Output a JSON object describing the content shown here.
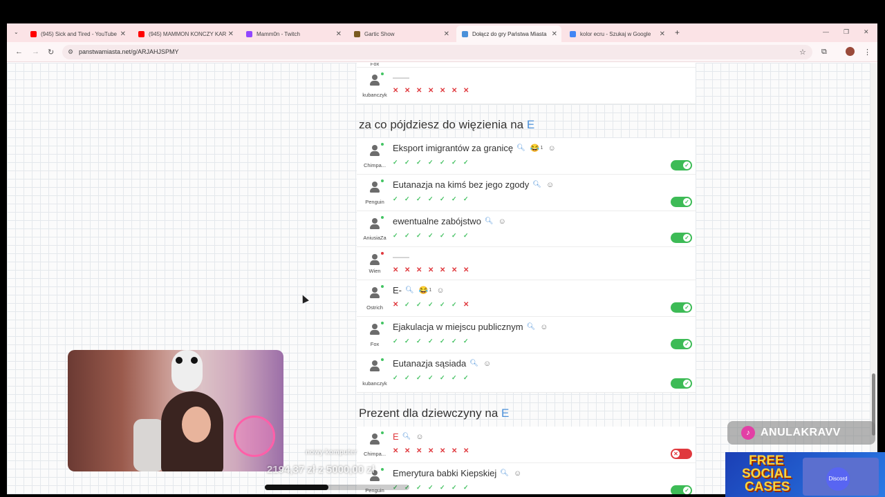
{
  "browser": {
    "tabs": [
      {
        "label": "(945) Sick and Tired - YouTube",
        "icon": "youtube-icon",
        "color": "#ff0000"
      },
      {
        "label": "(945) MAMMON KONCZY KAR",
        "icon": "youtube-icon",
        "color": "#ff0000"
      },
      {
        "label": "Mamm0n - Twitch",
        "icon": "twitch-icon",
        "color": "#9146ff"
      },
      {
        "label": "Gartic Show",
        "icon": "gartic-icon",
        "color": "#7a5a20"
      },
      {
        "label": "Dołącz do gry Państwa Miasta",
        "icon": "globe-icon",
        "color": "#4a90d9"
      },
      {
        "label": "kolor ecru - Szukaj w Google",
        "icon": "google-icon",
        "color": "#4285f4"
      }
    ],
    "url": "panstwamiasta.net/g/ARJAHJSPMY"
  },
  "sections": [
    {
      "category_prefix": "",
      "letter": "",
      "rows": [
        {
          "user": "Fox",
          "answer": "",
          "votes": [],
          "toggle": null,
          "online": true
        },
        {
          "user": "kubanczyk",
          "answer": "——",
          "votes": [
            "x",
            "x",
            "x",
            "x",
            "x",
            "x",
            "x"
          ],
          "toggle": null,
          "online": true
        }
      ]
    },
    {
      "category_prefix": "za co pójdziesz do więzienia na",
      "letter": "E",
      "rows": [
        {
          "user": "Chimpa...",
          "answer": "Eksport imigrantów za granicę",
          "emoji": "😂",
          "count": "1",
          "votes": [
            "v",
            "v",
            "v",
            "v",
            "v",
            "v",
            "v"
          ],
          "toggle": "on",
          "online": true
        },
        {
          "user": "Penguin",
          "answer": "Eutanazja na kimś bez jego zgody",
          "votes": [
            "v",
            "v",
            "v",
            "v",
            "v",
            "v",
            "v"
          ],
          "toggle": "on",
          "online": true
        },
        {
          "user": "AniusiaZa",
          "answer": "ewentualne zabójstwo",
          "votes": [
            "v",
            "v",
            "v",
            "v",
            "v",
            "v",
            "v"
          ],
          "toggle": "on",
          "online": true
        },
        {
          "user": "Wien",
          "answer": "——",
          "votes": [
            "x",
            "x",
            "x",
            "x",
            "x",
            "x",
            "x"
          ],
          "toggle": null,
          "online": false
        },
        {
          "user": "Ostrich",
          "answer": "E-",
          "emoji": "😂",
          "count": "1",
          "votes": [
            "x",
            "v",
            "v",
            "v",
            "v",
            "v",
            "x"
          ],
          "toggle": "on",
          "online": true
        },
        {
          "user": "Fox",
          "answer": "Ejakulacja w miejscu publicznym",
          "votes": [
            "v",
            "v",
            "v",
            "v",
            "v",
            "v",
            "v"
          ],
          "toggle": "on",
          "online": true
        },
        {
          "user": "kubanczyk",
          "answer": "Eutanazja sąsiada",
          "votes": [
            "v",
            "v",
            "v",
            "v",
            "v",
            "v",
            "v"
          ],
          "toggle": "on",
          "online": true
        }
      ]
    },
    {
      "category_prefix": "Prezent dla dziewczyny na",
      "letter": "E",
      "rows": [
        {
          "user": "Chimpa...",
          "answer": "E",
          "answer_red": true,
          "votes": [
            "x",
            "x",
            "x",
            "x",
            "x",
            "x",
            "x"
          ],
          "toggle": "off",
          "online": true
        },
        {
          "user": "Penguin",
          "answer": "Emerytura babki Kiepskiej",
          "votes": [
            "v",
            "v",
            "v",
            "v",
            "v",
            "v",
            "v"
          ],
          "toggle": "on",
          "online": true
        }
      ]
    }
  ],
  "stream_overlay": {
    "goal_label": "nowy komputer",
    "goal_amount": "2194,37 zł z 5000,00 zł",
    "goal_progress": 0.44,
    "handle": "ANULAKRAVV",
    "ad_line1": "FREE",
    "ad_line2": "SOCIAL",
    "ad_line3": "CASES",
    "ad_brand": "Discord"
  },
  "colors": {
    "accent": "#4a90d9",
    "ok": "#41c05f",
    "no": "#e0393e",
    "toggle_on": "#3dbb56"
  }
}
